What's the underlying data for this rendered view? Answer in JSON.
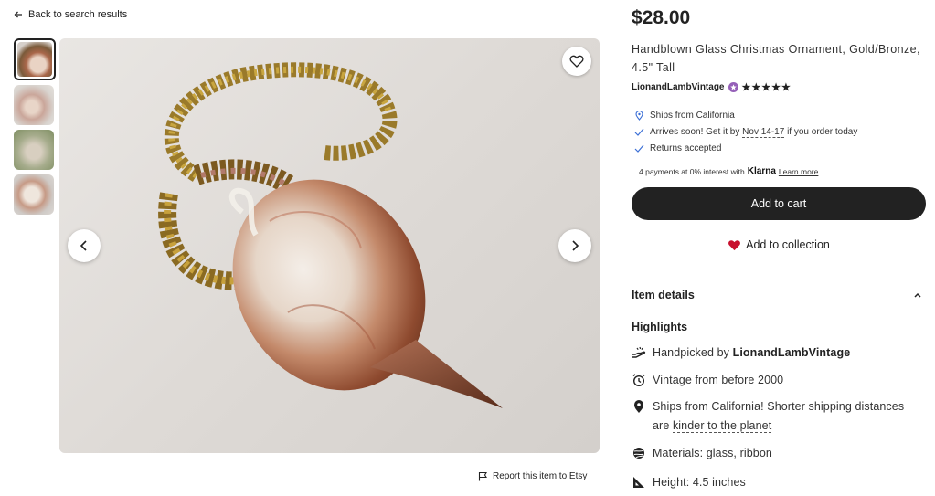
{
  "nav": {
    "back_label": "Back to search results"
  },
  "gallery": {
    "thumbnails": [
      "thumbnail-1",
      "thumbnail-2",
      "thumbnail-3",
      "thumbnail-4"
    ],
    "report_label": "Report this item to Etsy"
  },
  "listing": {
    "price": "$28.00",
    "title": "Handblown Glass Christmas Ornament, Gold/Bronze, 4.5\" Tall",
    "seller": "LionandLambVintage",
    "rating_stars": "★★★★★",
    "ships_from": "Ships from California",
    "arrives_prefix": "Arrives soon! Get it by ",
    "arrives_dates": "Nov 14-17",
    "arrives_suffix": " if you order today",
    "returns": "Returns accepted",
    "klarna_prefix": "4 payments at 0% interest with",
    "klarna_brand": "Klarna",
    "klarna_link": "Learn more",
    "add_to_cart": "Add to cart",
    "add_to_collection": "Add to collection"
  },
  "details": {
    "section_label": "Item details",
    "highlights_label": "Highlights",
    "handpicked_prefix": "Handpicked by ",
    "handpicked_seller": "LionandLambVintage",
    "vintage": "Vintage from before 2000",
    "ships_text": "Ships from California! Shorter shipping distances are ",
    "ships_link": "kinder to the planet",
    "materials": "Materials: glass, ribbon",
    "height": "Height: 4.5 inches"
  },
  "colors": {
    "primary_button": "#222222",
    "heart": "#c8102e",
    "star_seller_badge": "#9560b8",
    "location_icon": "#3b6fd6"
  }
}
